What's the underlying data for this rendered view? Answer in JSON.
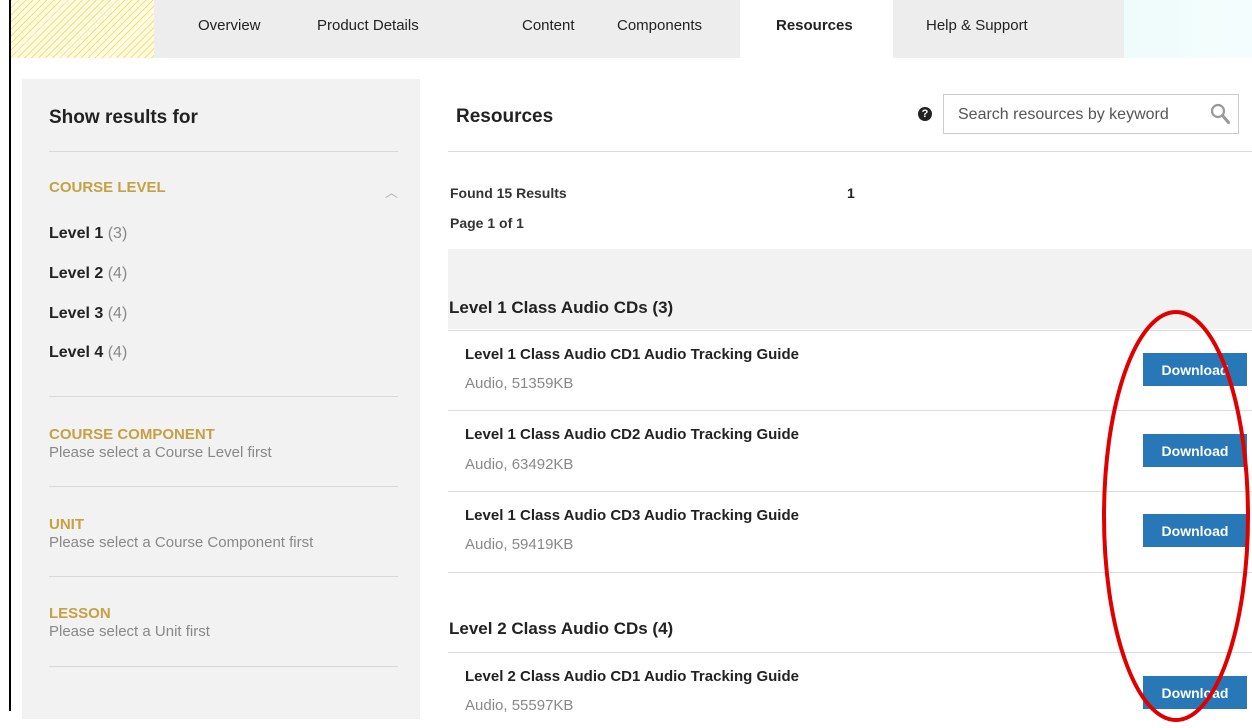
{
  "tabs": [
    "Overview",
    "Product Details",
    "Content",
    "Components",
    "Resources",
    "Help & Support"
  ],
  "active_tab": "Resources",
  "sidebar": {
    "title": "Show results for",
    "course_level": {
      "heading": "COURSE LEVEL",
      "levels": [
        {
          "label": "Level 1",
          "count": "(3)"
        },
        {
          "label": "Level 2",
          "count": "(4)"
        },
        {
          "label": "Level 3",
          "count": "(4)"
        },
        {
          "label": "Level 4",
          "count": "(4)"
        }
      ]
    },
    "course_component": {
      "heading": "COURSE COMPONENT",
      "note": "Please select a Course Level first"
    },
    "unit": {
      "heading": "UNIT",
      "note": "Please select a Course Component first"
    },
    "lesson": {
      "heading": "LESSON",
      "note": "Please select a Unit first"
    }
  },
  "main": {
    "title": "Resources",
    "help_glyph": "?",
    "search_placeholder": "Search resources by keyword",
    "found": "Found 15 Results",
    "page_number": "1",
    "page_of": "Page 1 of 1",
    "groups": [
      {
        "title": "Level 1 Class Audio CDs (3)",
        "items": [
          {
            "title": "Level 1 Class Audio CD1 Audio Tracking Guide",
            "meta": "Audio, 51359KB",
            "button": "Download"
          },
          {
            "title": "Level 1 Class Audio CD2 Audio Tracking Guide",
            "meta": "Audio, 63492KB",
            "button": "Download"
          },
          {
            "title": "Level 1 Class Audio CD3 Audio Tracking Guide",
            "meta": "Audio, 59419KB",
            "button": "Download"
          }
        ]
      },
      {
        "title": "Level 2 Class Audio CDs (4)",
        "items": [
          {
            "title": "Level 2 Class Audio CD1 Audio Tracking Guide",
            "meta": "Audio, 55597KB",
            "button": "Download"
          }
        ]
      }
    ]
  },
  "colors": {
    "accent_gold": "#c5a144",
    "button_blue": "#2878b8",
    "annotation_red": "#e00000"
  }
}
